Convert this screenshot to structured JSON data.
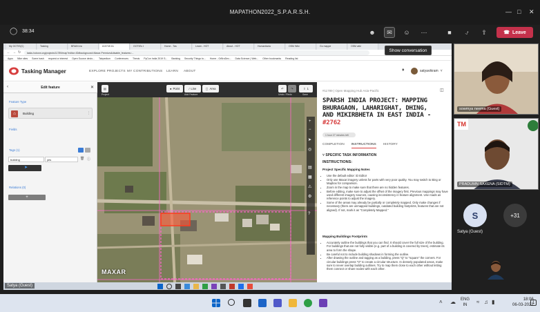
{
  "teams": {
    "window_title": "MAPATHON2022_S.P.A.R.S.H.",
    "timer": "38:34",
    "leave_label": "Leave",
    "tooltip": "Show conversation",
    "presenter_name": "Satya (Guest)",
    "participants": [
      {
        "name": "sowmya neema (Guest)"
      },
      {
        "name": "PRADUMN SAXENA (SIDTM)"
      },
      {
        "name": "Satya (Guest)",
        "initial": "S"
      }
    ],
    "more_count": "+31",
    "clock_time": "18:06",
    "clock_date": "06-03-2022",
    "lang": "ENG",
    "lang_region": "IN"
  },
  "browser": {
    "tabs": [
      "My GOTIS(C)",
      "Tasking",
      "BRAIN inc",
      "#10745 Im",
      "GOTM's t",
      "Home - Tas",
      "Learn - HOT",
      "About - HOT",
      "Humanitaria",
      "OSM Wiki",
      "Go mappe",
      "OSM wiki"
    ],
    "url": "tasks.hotosm.org/projects/11789/map?editor=ID#background=Maxar-Premium&disable_features=...",
    "bookmarks": [
      "Apps",
      "Nike sites",
      "Some hash",
      "request or interest",
      "Open Source devlo...",
      "Tabpedium",
      "Conferences",
      "Thesis",
      "PyCon India 2019 S...",
      "Banking",
      "Security Things to...",
      "Home - GrBroDev...",
      "Data Science | Web...",
      "Other bookmarks",
      "Reading list"
    ]
  },
  "tm": {
    "brand": "Tasking Manager",
    "nav": [
      "EXPLORE PROJECTS",
      "MY CONTRIBUTIONS",
      "LEARN",
      "ABOUT"
    ],
    "user": "satyavikram"
  },
  "edit": {
    "title": "Edit feature",
    "feature_type_label": "Feature Type",
    "feature_name": "Building",
    "fields_label": "Fields",
    "tags_label": "Tags (1)",
    "tag_key": "building",
    "tag_value": "yes",
    "relations_label": "Relations (0)",
    "add": "+"
  },
  "map": {
    "buttons": {
      "point": "Point",
      "line": "Line",
      "area": "Area"
    },
    "sub": {
      "project": "Project",
      "add_feature": "Add Feature",
      "undo_redo": "Undo / Redo",
      "save": "Save"
    },
    "imagery": "MAXAR",
    "save_count": "1"
  },
  "instructions": {
    "project_id": "#11789 | Open Mapping Hub Asia-Pacific",
    "title": "SPARSH INDIA PROJECT: MAPPING BHURAGAON, LAHARIGHAT, DHING, AND MIKIRBHETA IN EAST INDIA",
    "number": "#2762",
    "pill": "1 hour 27 minutes left",
    "tabs": [
      "COMPLETION",
      "INSTRUCTIONS",
      "HISTORY"
    ],
    "section": "SPECIFIC TASK INFORMATION",
    "heading": "INSTRUCTIONS:",
    "sub1": "Project Specific Mapping Notes",
    "notes1": [
      "Use the default editor: iD Editor",
      "Only use Maxar imagery unless for parts with very poor quality. You may switch to Bing or Mapbox for comparison.",
      "Zoom in the map to make sure that there are no hidden features.",
      "Before editing, make sure to adjust the offset of the imagery first. Previous mappings may have used different imagery sources, causing inconsistency in feature alignment. Use roads as reference points to adjust the imagery.",
      "Some of the areas may already be partially or completely mapped. Only make changes if necessary (there are unmapped buildings, outdated building footprints, features that are not aligned). If not, mark it as \"Completely Mapped.\""
    ],
    "sub2": "Mapping Buildings Footprints",
    "notes2": [
      "Accurately outline the buildings that you can find. It should cover the full size of the building. For buildings that are not fully visible (e.g. part of a building is covered by trees), estimate its area to form the shape.",
      "Be careful not to include building shadows in forming the outline.",
      "After drawing the outline and tagging as a building, press \"Q\" to \"square\" the corners. For circular buildings press \"O\" to create a circular structure. In densely populated areas, make sure to never overlap building outlines. Try to map them close to each other without letting them connect or share nodes with each other."
    ]
  }
}
